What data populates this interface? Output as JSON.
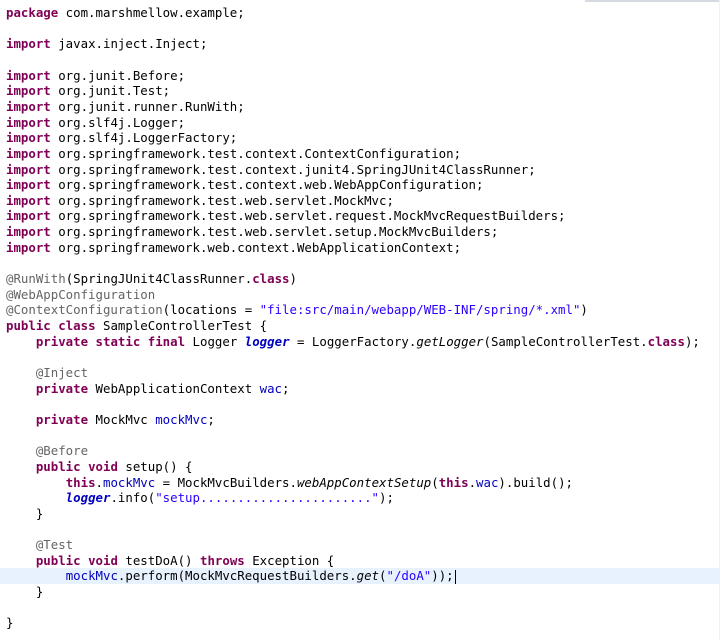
{
  "editor": {
    "lines": [
      [
        [
          "kw",
          "package"
        ],
        [
          "pl",
          " com.marshmellow.example;"
        ]
      ],
      [],
      [
        [
          "kw",
          "import"
        ],
        [
          "pl",
          " javax.inject.Inject;"
        ]
      ],
      [],
      [
        [
          "kw",
          "import"
        ],
        [
          "pl",
          " org.junit.Before;"
        ]
      ],
      [
        [
          "kw",
          "import"
        ],
        [
          "pl",
          " org.junit.Test;"
        ]
      ],
      [
        [
          "kw",
          "import"
        ],
        [
          "pl",
          " org.junit.runner.RunWith;"
        ]
      ],
      [
        [
          "kw",
          "import"
        ],
        [
          "pl",
          " org.slf4j.Logger;"
        ]
      ],
      [
        [
          "kw",
          "import"
        ],
        [
          "pl",
          " org.slf4j.LoggerFactory;"
        ]
      ],
      [
        [
          "kw",
          "import"
        ],
        [
          "pl",
          " org.springframework.test.context.ContextConfiguration;"
        ]
      ],
      [
        [
          "kw",
          "import"
        ],
        [
          "pl",
          " org.springframework.test.context.junit4.SpringJUnit4ClassRunner;"
        ]
      ],
      [
        [
          "kw",
          "import"
        ],
        [
          "pl",
          " org.springframework.test.context.web.WebAppConfiguration;"
        ]
      ],
      [
        [
          "kw",
          "import"
        ],
        [
          "pl",
          " org.springframework.test.web.servlet.MockMvc;"
        ]
      ],
      [
        [
          "kw",
          "import"
        ],
        [
          "pl",
          " org.springframework.test.web.servlet.request.MockMvcRequestBuilders;"
        ]
      ],
      [
        [
          "kw",
          "import"
        ],
        [
          "pl",
          " org.springframework.test.web.servlet.setup.MockMvcBuilders;"
        ]
      ],
      [
        [
          "kw",
          "import"
        ],
        [
          "pl",
          " org.springframework.web.context.WebApplicationContext;"
        ]
      ],
      [],
      [
        [
          "ann",
          "@RunWith"
        ],
        [
          "pl",
          "(SpringJUnit4ClassRunner."
        ],
        [
          "kw",
          "class"
        ],
        [
          "pl",
          ")"
        ]
      ],
      [
        [
          "ann",
          "@WebAppConfiguration"
        ]
      ],
      [
        [
          "ann",
          "@ContextConfiguration"
        ],
        [
          "pl",
          "(locations = "
        ],
        [
          "str",
          "\"file:src/main/webapp/WEB-INF/spring/*.xml\""
        ],
        [
          "pl",
          ")"
        ]
      ],
      [
        [
          "kw",
          "public"
        ],
        [
          "pl",
          " "
        ],
        [
          "kw",
          "class"
        ],
        [
          "pl",
          " SampleControllerTest {"
        ]
      ],
      [
        [
          "pl",
          "    "
        ],
        [
          "kw",
          "private"
        ],
        [
          "pl",
          " "
        ],
        [
          "kw",
          "static"
        ],
        [
          "pl",
          " "
        ],
        [
          "kw",
          "final"
        ],
        [
          "pl",
          " Logger "
        ],
        [
          "sfld",
          "logger"
        ],
        [
          "pl",
          " = LoggerFactory."
        ],
        [
          "smth",
          "getLogger"
        ],
        [
          "pl",
          "(SampleControllerTest."
        ],
        [
          "kw",
          "class"
        ],
        [
          "pl",
          ");"
        ]
      ],
      [],
      [
        [
          "pl",
          "    "
        ],
        [
          "ann",
          "@Inject"
        ]
      ],
      [
        [
          "pl",
          "    "
        ],
        [
          "kw",
          "private"
        ],
        [
          "pl",
          " WebApplicationContext "
        ],
        [
          "fld",
          "wac"
        ],
        [
          "pl",
          ";"
        ]
      ],
      [],
      [
        [
          "pl",
          "    "
        ],
        [
          "kw",
          "private"
        ],
        [
          "pl",
          " MockMvc "
        ],
        [
          "fld",
          "mockMvc"
        ],
        [
          "pl",
          ";"
        ]
      ],
      [],
      [
        [
          "pl",
          "    "
        ],
        [
          "ann",
          "@Before"
        ]
      ],
      [
        [
          "pl",
          "    "
        ],
        [
          "kw",
          "public"
        ],
        [
          "pl",
          " "
        ],
        [
          "kw",
          "void"
        ],
        [
          "pl",
          " setup() {"
        ]
      ],
      [
        [
          "pl",
          "        "
        ],
        [
          "kw",
          "this"
        ],
        [
          "pl",
          "."
        ],
        [
          "fld",
          "mockMvc"
        ],
        [
          "pl",
          " = MockMvcBuilders."
        ],
        [
          "smth",
          "webAppContextSetup"
        ],
        [
          "pl",
          "("
        ],
        [
          "kw",
          "this"
        ],
        [
          "pl",
          "."
        ],
        [
          "fld",
          "wac"
        ],
        [
          "pl",
          ").build();"
        ]
      ],
      [
        [
          "pl",
          "        "
        ],
        [
          "sfld",
          "logger"
        ],
        [
          "pl",
          ".info("
        ],
        [
          "str",
          "\"setup.......................\""
        ],
        [
          "pl",
          ");"
        ]
      ],
      [
        [
          "pl",
          "    }"
        ]
      ],
      [],
      [
        [
          "pl",
          "    "
        ],
        [
          "ann",
          "@Test"
        ]
      ],
      [
        [
          "pl",
          "    "
        ],
        [
          "kw",
          "public"
        ],
        [
          "pl",
          " "
        ],
        [
          "kw",
          "void"
        ],
        [
          "pl",
          " testDoA() "
        ],
        [
          "kw",
          "throws"
        ],
        [
          "pl",
          " Exception {"
        ]
      ],
      [
        [
          "pl",
          "        "
        ],
        [
          "fld",
          "mockMvc"
        ],
        [
          "pl",
          ".perform(MockMvcRequestBuilders."
        ],
        [
          "smth",
          "get"
        ],
        [
          "pl",
          "("
        ],
        [
          "str",
          "\"/doA\""
        ],
        [
          "pl",
          "));"
        ]
      ],
      [
        [
          "pl",
          "    }"
        ]
      ],
      [],
      [
        [
          "pl",
          "}"
        ]
      ]
    ],
    "current_line_index": 36,
    "colors": {
      "keyword": "#7f0055",
      "annotation": "#646464",
      "string": "#2a00ff",
      "field": "#0000c0",
      "current_line_highlight": "#e8f2fe"
    }
  }
}
